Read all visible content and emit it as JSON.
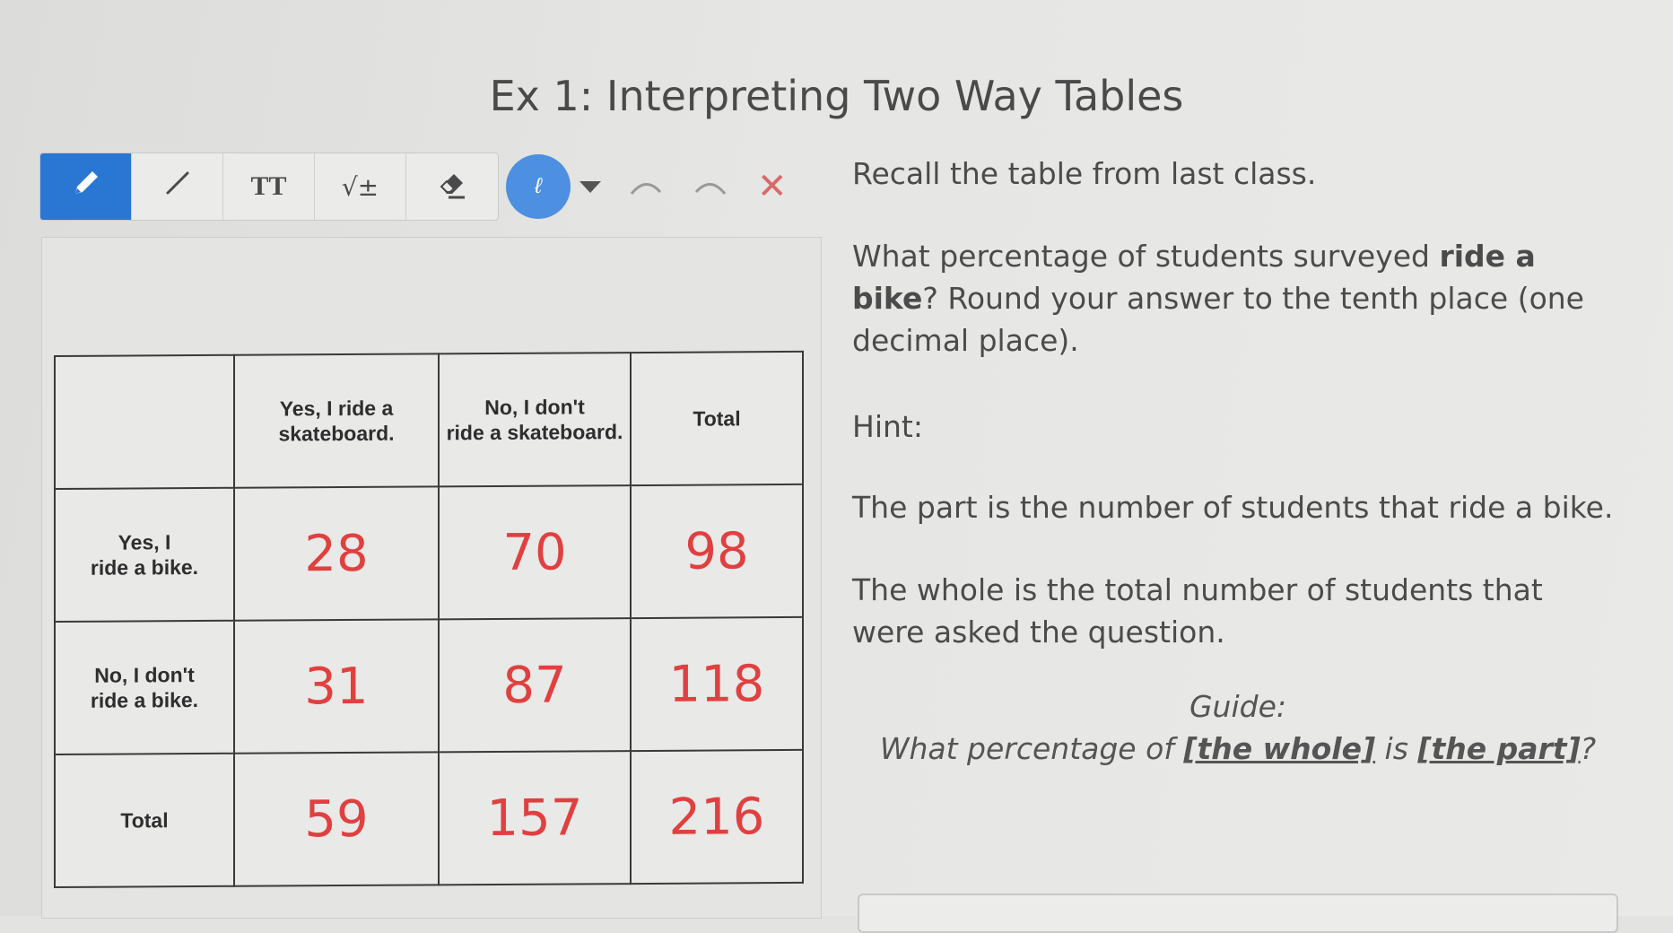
{
  "title": "Ex 1: Interpreting Two Way Tables",
  "toolbar": {
    "tools": [
      "pen",
      "line",
      "text",
      "math",
      "eraser"
    ],
    "text_tool_label": "TT",
    "math_tool_label": "√±",
    "color_glyph": "ℓ",
    "accent_color": "#2a77d3",
    "close_label": "✕"
  },
  "table": {
    "headers": [
      "",
      "Yes, I ride a skateboard.",
      "No, I don't ride a skateboard.",
      "Total"
    ],
    "header_lines": [
      [
        "",
        ""
      ],
      [
        "Yes, I ride a",
        "skateboard."
      ],
      [
        "No, I don't",
        "ride a skateboard."
      ],
      [
        "Total",
        ""
      ]
    ],
    "rows": [
      {
        "label_lines": [
          "Yes, I",
          "ride a bike."
        ],
        "values": [
          "28",
          "70",
          "98"
        ]
      },
      {
        "label_lines": [
          "No, I don't",
          "ride a bike."
        ],
        "values": [
          "31",
          "87",
          "118"
        ]
      },
      {
        "label_lines": [
          "Total",
          ""
        ],
        "values": [
          "59",
          "157",
          "216"
        ]
      }
    ],
    "number_color": "#e0403f"
  },
  "panel": {
    "recall": "Recall the table from last class.",
    "question_pre": "What percentage of students surveyed ",
    "question_bold": "ride a bike",
    "question_post": "? Round your answer to the tenth place  (one decimal place).",
    "hint": "Hint:",
    "part": "The part is the number of students that ride a bike.",
    "whole": "The whole is the total number of students that were asked the question.",
    "guide_label": "Guide:",
    "guide_pre": "What percentage of ",
    "guide_whole": "[the whole]",
    "guide_mid": " is ",
    "guide_part": "[the part]",
    "guide_post": "?"
  }
}
